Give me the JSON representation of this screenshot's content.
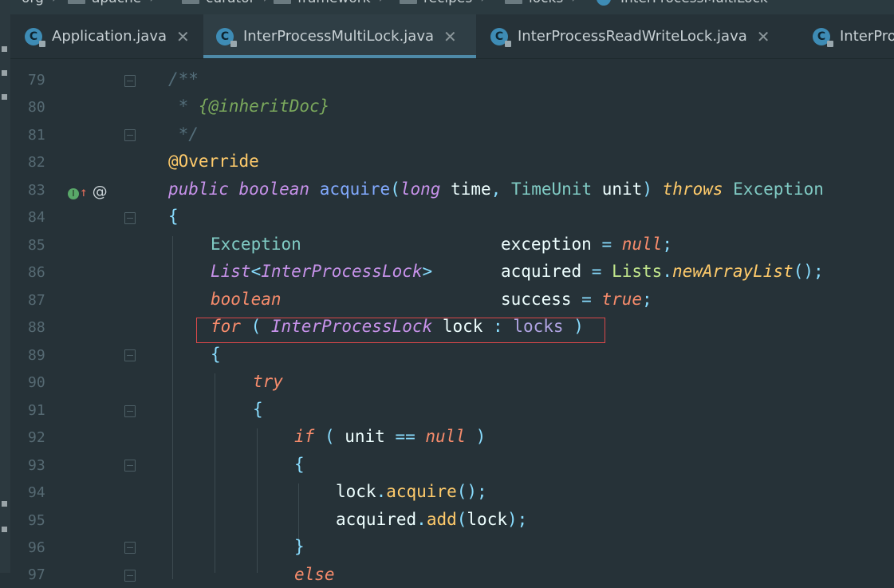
{
  "breadcrumb": [
    "org",
    "apache",
    "curator",
    "framework",
    "recipes",
    "locks",
    "InterProcessMultiLock"
  ],
  "tabs": [
    {
      "label": "Application.java",
      "icon": "C",
      "active": false
    },
    {
      "label": "InterProcessMultiLock.java",
      "icon": "C",
      "active": true
    },
    {
      "label": "InterProcessReadWriteLock.java",
      "icon": "C",
      "active": false
    },
    {
      "label": "InterPro",
      "icon": "C",
      "active": false
    }
  ],
  "tab_close_glyph": "✕",
  "line_numbers": [
    "79",
    "80",
    "81",
    "82",
    "83",
    "84",
    "85",
    "86",
    "87",
    "88",
    "89",
    "90",
    "91",
    "92",
    "93",
    "94",
    "95",
    "96",
    "97"
  ],
  "gutter_marks": {
    "implements_icon": "I",
    "arrow": "↑",
    "at": "@"
  },
  "code": {
    "l79": "/**",
    "l80a": " * ",
    "l80b": "{@inheritDoc}",
    "l81": " */",
    "l82": "@Override",
    "l83_kw1": "public",
    "l83_kw2": "boolean",
    "l83_name": "acquire",
    "l83_p1": "(",
    "l83_kw3": "long",
    "l83_a1": " time",
    "l83_c": ", ",
    "l83_t": "TimeUnit",
    "l83_a2": " unit",
    "l83_p2": ")",
    "l83_throws": "throws",
    "l83_ex": "Exception",
    "l84": "{",
    "l85_type": "Exception",
    "l85_var": "exception",
    "l85_eq": " = ",
    "l85_val": "null",
    "l85_semi": ";",
    "l86_t1": "List",
    "l86_lt": "<",
    "l86_t2": "InterProcessLock",
    "l86_gt": ">",
    "l86_var": "acquired",
    "l86_eq": " = ",
    "l86_cls": "Lists",
    "l86_dot": ".",
    "l86_m": "newArrayList",
    "l86_end": "();",
    "l87_type": "boolean",
    "l87_var": "success",
    "l87_eq": " = ",
    "l87_val": "true",
    "l87_semi": ";",
    "l88_for": "for",
    "l88_p1": " ( ",
    "l88_t": "InterProcessLock",
    "l88_v": " lock",
    "l88_colon": " : ",
    "l88_f": "locks",
    "l88_p2": " )",
    "l89": "{",
    "l90": "try",
    "l91": "{",
    "l92_if": "if",
    "l92_p1": " ( ",
    "l92_v": "unit",
    "l92_op": " == ",
    "l92_null": "null",
    "l92_p2": " )",
    "l93": "{",
    "l94_v": "lock",
    "l94_dot": ".",
    "l94_m": "acquire",
    "l94_end": "();",
    "l95_v": "acquired",
    "l95_dot": ".",
    "l95_m": "add",
    "l95_p1": "(",
    "l95_a": "lock",
    "l95_end": ");",
    "l96": "}",
    "l97": "else"
  },
  "colors": {
    "background": "#263238",
    "highlight_box": "#d9484a",
    "active_tab_underline": "#4e8aa8"
  }
}
